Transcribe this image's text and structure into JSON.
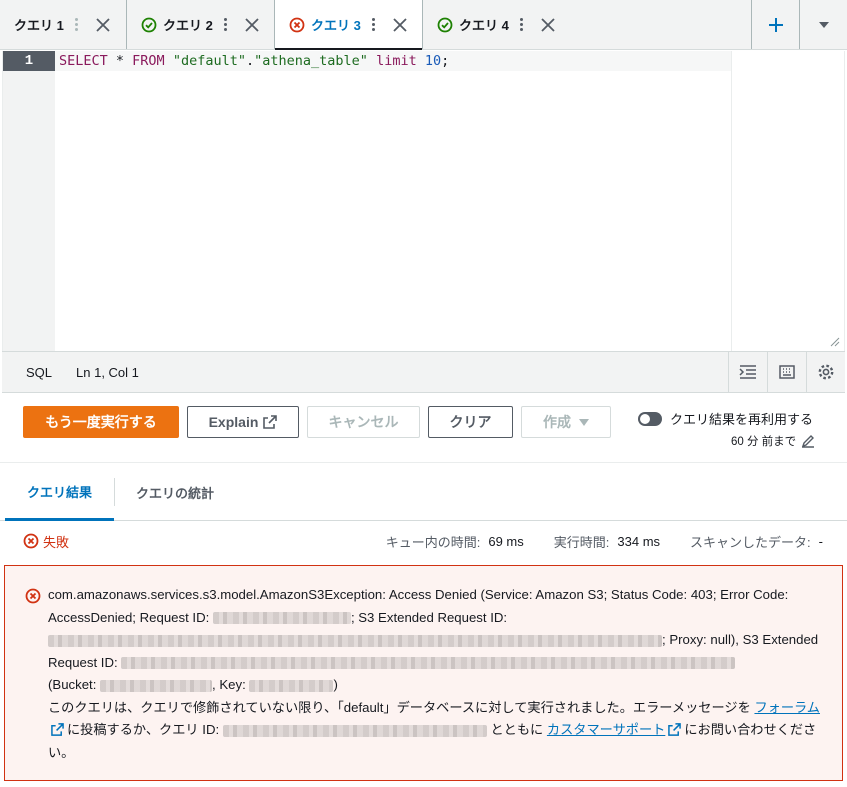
{
  "tabs": [
    {
      "label": "クエリ 1",
      "status": "none",
      "active": false
    },
    {
      "label": "クエリ 2",
      "status": "success",
      "active": false
    },
    {
      "label": "クエリ 3",
      "status": "error",
      "active": true
    },
    {
      "label": "クエリ 4",
      "status": "success",
      "active": false
    }
  ],
  "editor": {
    "line_number": "1",
    "tokens": {
      "select": "SELECT",
      "star": " * ",
      "from": "FROM",
      "space": " ",
      "db": "\"default\"",
      "dot": ".",
      "table": "\"athena_table\"",
      "limit": "limit",
      "num": "10",
      "semi": ";"
    }
  },
  "statusbar": {
    "language": "SQL",
    "position": "Ln 1, Col 1"
  },
  "actions": {
    "rerun": "もう一度実行する",
    "explain": "Explain",
    "cancel": "キャンセル",
    "clear": "クリア",
    "create": "作成",
    "reuse_label": "クエリ結果を再利用する",
    "reuse_sub": "60 分 前まで"
  },
  "result_tabs": {
    "results": "クエリ結果",
    "stats": "クエリの統計"
  },
  "stats": {
    "status": "失敗",
    "queue_label": "キュー内の時間:",
    "queue_value": "69 ms",
    "exec_label": "実行時間:",
    "exec_value": "334 ms",
    "scan_label": "スキャンしたデータ:",
    "scan_value": "-"
  },
  "error": {
    "line1": "com.amazonaws.services.s3.model.AmazonS3Exception: Access Denied (Service: Amazon S3; Status Code: 403; Error Code: AccessDenied; Request ID:",
    "line1b": "; S3 Extended Request ID:",
    "line2": "; Proxy: null), S3 Extended Request ID:",
    "bucket_prefix": "(Bucket:",
    "key_prefix": ", Key:",
    "bucket_suffix": ")",
    "msg1": "このクエリは、クエリで修飾されていない限り、「default」データベースに対して実行されました。エラーメッセージを",
    "forum": "フォーラム",
    "msg2": "に投稿するか、クエリ ID:",
    "msg3": "とともに",
    "support": "カスタマーサポート",
    "msg4": "にお問い合わせください。"
  },
  "colors": {
    "accent": "#0073bb",
    "primary_button": "#ec7211",
    "error": "#d13212",
    "success": "#1d8102"
  }
}
